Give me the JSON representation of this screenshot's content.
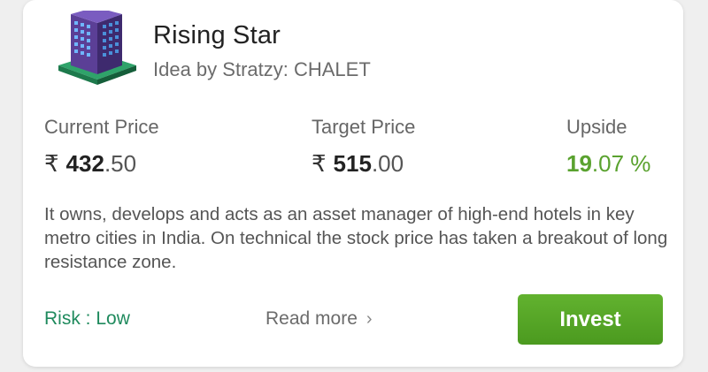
{
  "card": {
    "title": "Rising Star",
    "subtitle": "Idea by Stratzy: CHALET",
    "logo_icon": "hotel-building-icon"
  },
  "prices": {
    "current_label": "Current Price",
    "current_symbol": "₹",
    "current_int": "432",
    "current_dec": ".50",
    "target_label": "Target Price",
    "target_symbol": "₹",
    "target_int": "515",
    "target_dec": ".00",
    "upside_label": "Upside",
    "upside_int": "19",
    "upside_dec": ".07 %"
  },
  "description": "It owns, develops and acts as an asset manager of high-end hotels in key metro cities in India. On technical the stock price has taken a breakout of long resistance zone.",
  "footer": {
    "risk_label": "Risk : Low",
    "read_more": "Read more",
    "read_more_icon": "chevron-right-icon",
    "invest_label": "Invest"
  },
  "colors": {
    "accent_green": "#5aa22f",
    "risk_green": "#1f8a5d",
    "button_green": "#56a726",
    "building_purple": "#5a3e92",
    "base_green": "#2e8b57"
  }
}
